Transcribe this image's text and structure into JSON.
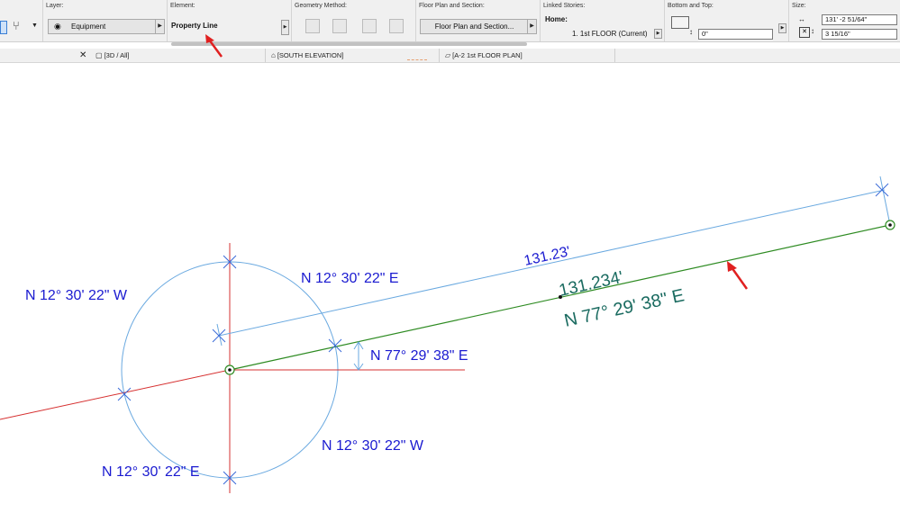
{
  "toolbar": {
    "layer": {
      "label": "Layer:",
      "value": "Equipment"
    },
    "element": {
      "label": "Element:",
      "value": "Property Line"
    },
    "geometry": {
      "label": "Geometry Method:"
    },
    "floorplan": {
      "label": "Floor Plan and Section:",
      "value": "Floor Plan and Section..."
    },
    "linked": {
      "label": "Linked Stories:",
      "home_label": "Home:",
      "home_value": "1. 1st FLOOR (Current)"
    },
    "bottomtop": {
      "label": "Bottom and Top:",
      "value": "0\""
    },
    "size": {
      "label": "Size:",
      "value1": "131' -2 51/64\"",
      "value2": "3 15/16\""
    }
  },
  "tabs": [
    {
      "label": "[3D / All]",
      "icon": "cube-icon"
    },
    {
      "label": "[SOUTH ELEVATION]",
      "icon": "house-elevation-icon"
    },
    {
      "label": "[A-2 1st FLOOR PLAN]",
      "icon": "floor-plan-icon"
    }
  ],
  "canvas": {
    "annotations": {
      "nw_top": "N 12° 30' 22\" W",
      "ne_top": "N 12° 30' 22\" E",
      "bearing_small": "N 77° 29' 38\" E",
      "nw_bottom": "N 12° 30' 22\" W",
      "ne_bottom": "N 12° 30' 22\" E",
      "dim_blue": "131.23'",
      "dim_green": "131.234'",
      "bearing_large": "N 77° 29' 38\" E"
    },
    "colors": {
      "blue_text": "#1a1ad0",
      "teal_text": "#1a6b60",
      "blue_line": "#6aa9e0",
      "green_line": "#2e8b22",
      "red_line": "#d63030",
      "arrow": "#e02020"
    }
  }
}
